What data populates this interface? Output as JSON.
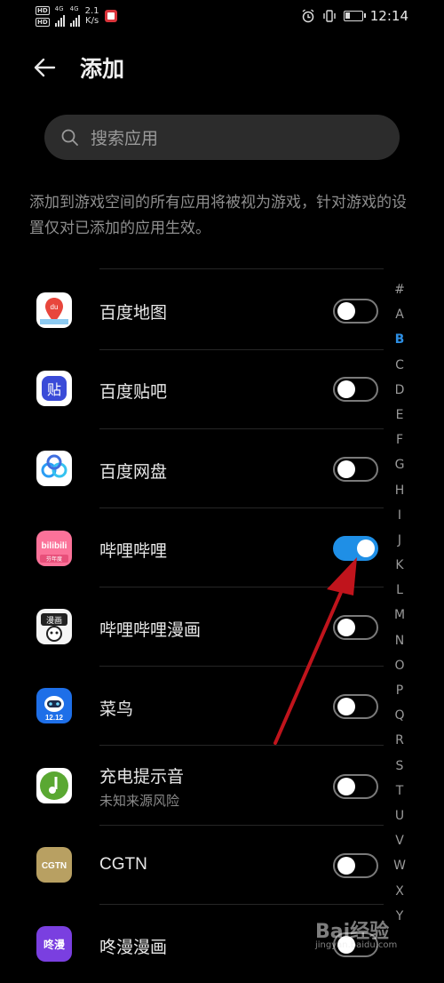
{
  "status_bar": {
    "hd1": "HD",
    "hd2": "HD",
    "net1": "4G",
    "net2": "4G",
    "speed_value": "2.1",
    "speed_unit": "K/s",
    "time": "12:14"
  },
  "header": {
    "title": "添加"
  },
  "search": {
    "placeholder": "搜索应用"
  },
  "description": "添加到游戏空间的所有应用将被视为游戏，针对游戏的设置仅对已添加的应用生效。",
  "apps": [
    {
      "name": "百度地图",
      "subtitle": "",
      "enabled": false,
      "icon": "baidu-map-icon"
    },
    {
      "name": "百度贴吧",
      "subtitle": "",
      "enabled": false,
      "icon": "baidu-tieba-icon"
    },
    {
      "name": "百度网盘",
      "subtitle": "",
      "enabled": false,
      "icon": "baidu-netdisk-icon"
    },
    {
      "name": "哔哩哔哩",
      "subtitle": "",
      "enabled": true,
      "icon": "bilibili-icon"
    },
    {
      "name": "哔哩哔哩漫画",
      "subtitle": "",
      "enabled": false,
      "icon": "bilibili-comics-icon"
    },
    {
      "name": "菜鸟",
      "subtitle": "",
      "enabled": false,
      "icon": "cainiao-icon"
    },
    {
      "name": "充电提示音",
      "subtitle": "未知来源风险",
      "enabled": false,
      "icon": "charging-tone-icon"
    },
    {
      "name": "CGTN",
      "subtitle": "",
      "enabled": false,
      "icon": "cgtn-icon"
    },
    {
      "name": "咚漫漫画",
      "subtitle": "",
      "enabled": false,
      "icon": "dongman-comics-icon"
    }
  ],
  "icon_text": {
    "baidu_map": "du",
    "tieba": "贴",
    "bilibili": "bilibili",
    "bilibili_sub": "芬年度",
    "comics": "漫画",
    "cainiao_date": "12.12",
    "cgtn": "CGTN",
    "dongman": "咚漫"
  },
  "alpha_index": [
    "#",
    "A",
    "B",
    "C",
    "D",
    "E",
    "F",
    "G",
    "H",
    "I",
    "J",
    "K",
    "L",
    "M",
    "N",
    "O",
    "P",
    "Q",
    "R",
    "S",
    "T",
    "U",
    "V",
    "W",
    "X",
    "Y"
  ],
  "alpha_active": "B",
  "watermark": {
    "brand": "Bai经验",
    "url": "jingyan.baidu.com"
  },
  "colors": {
    "accent": "#1f8fe6",
    "annotation_arrow": "#c0141c",
    "background": "#000000"
  }
}
